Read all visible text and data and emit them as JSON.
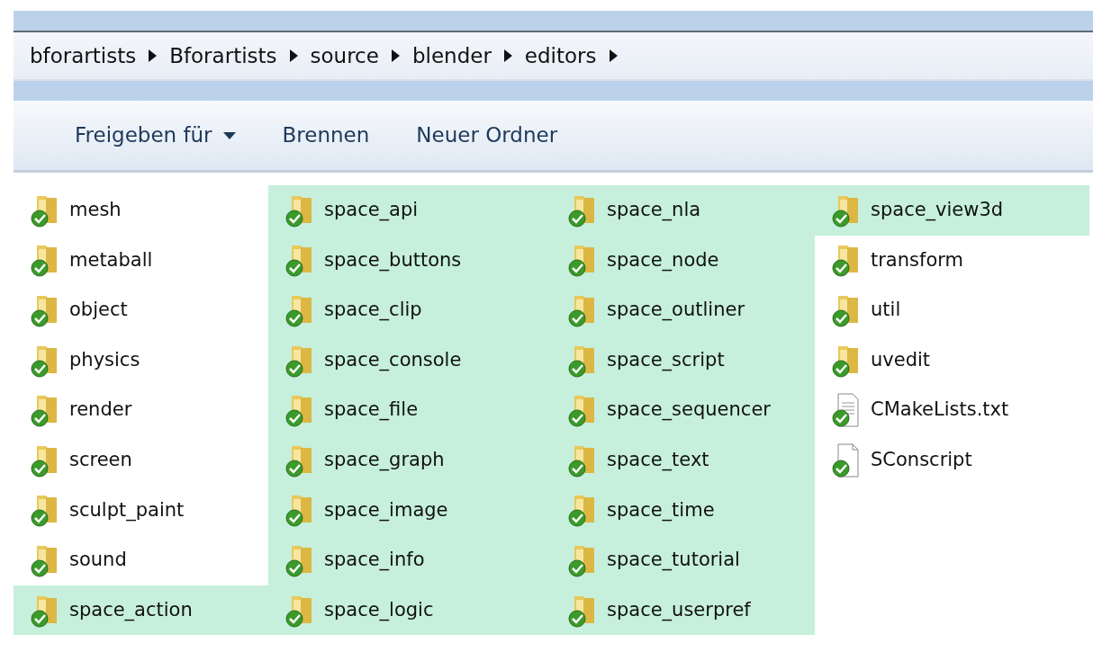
{
  "breadcrumb": [
    {
      "label": "bforartists"
    },
    {
      "label": "Bforartists"
    },
    {
      "label": "source"
    },
    {
      "label": "blender"
    },
    {
      "label": "editors"
    }
  ],
  "toolbar": [
    {
      "label": "Freigeben für",
      "dropdown": true
    },
    {
      "label": "Brennen",
      "dropdown": false
    },
    {
      "label": "Neuer Ordner",
      "dropdown": false
    }
  ],
  "files": [
    {
      "name": "mesh",
      "kind": "folder",
      "selected": false
    },
    {
      "name": "metaball",
      "kind": "folder",
      "selected": false
    },
    {
      "name": "object",
      "kind": "folder",
      "selected": false
    },
    {
      "name": "physics",
      "kind": "folder",
      "selected": false
    },
    {
      "name": "render",
      "kind": "folder",
      "selected": false
    },
    {
      "name": "screen",
      "kind": "folder",
      "selected": false
    },
    {
      "name": "sculpt_paint",
      "kind": "folder",
      "selected": false
    },
    {
      "name": "sound",
      "kind": "folder",
      "selected": false
    },
    {
      "name": "space_action",
      "kind": "folder",
      "selected": true
    },
    {
      "name": "space_api",
      "kind": "folder",
      "selected": true
    },
    {
      "name": "space_buttons",
      "kind": "folder",
      "selected": true
    },
    {
      "name": "space_clip",
      "kind": "folder",
      "selected": true
    },
    {
      "name": "space_console",
      "kind": "folder",
      "selected": true
    },
    {
      "name": "space_file",
      "kind": "folder",
      "selected": true
    },
    {
      "name": "space_graph",
      "kind": "folder",
      "selected": true
    },
    {
      "name": "space_image",
      "kind": "folder",
      "selected": true
    },
    {
      "name": "space_info",
      "kind": "folder",
      "selected": true
    },
    {
      "name": "space_logic",
      "kind": "folder",
      "selected": true
    },
    {
      "name": "space_nla",
      "kind": "folder",
      "selected": true
    },
    {
      "name": "space_node",
      "kind": "folder",
      "selected": true
    },
    {
      "name": "space_outliner",
      "kind": "folder",
      "selected": true
    },
    {
      "name": "space_script",
      "kind": "folder",
      "selected": true
    },
    {
      "name": "space_sequencer",
      "kind": "folder",
      "selected": true
    },
    {
      "name": "space_text",
      "kind": "folder",
      "selected": true
    },
    {
      "name": "space_time",
      "kind": "folder",
      "selected": true
    },
    {
      "name": "space_tutorial",
      "kind": "folder",
      "selected": true
    },
    {
      "name": "space_userpref",
      "kind": "folder",
      "selected": true
    },
    {
      "name": "space_view3d",
      "kind": "folder",
      "selected": true
    },
    {
      "name": "transform",
      "kind": "folder",
      "selected": false
    },
    {
      "name": "util",
      "kind": "folder",
      "selected": false
    },
    {
      "name": "uvedit",
      "kind": "folder",
      "selected": false
    },
    {
      "name": "CMakeLists.txt",
      "kind": "textfile",
      "selected": false
    },
    {
      "name": "SConscript",
      "kind": "file",
      "selected": false
    }
  ]
}
